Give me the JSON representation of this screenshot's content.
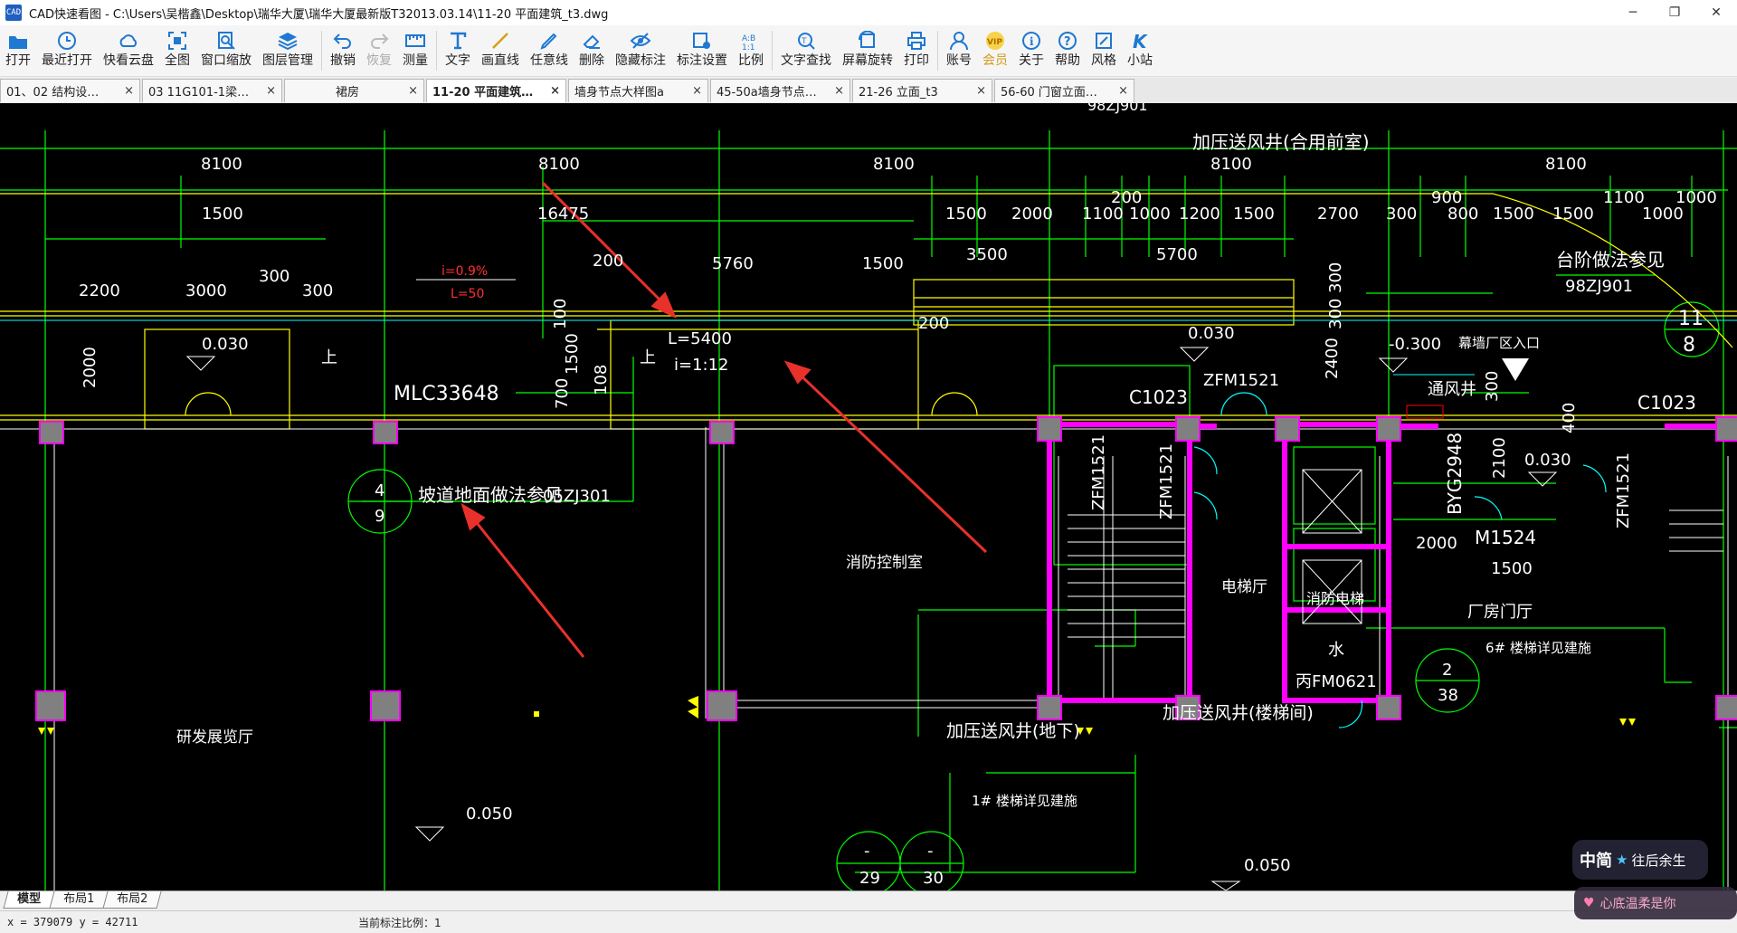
{
  "window": {
    "app_logo": "CAD",
    "title": "CAD快速看图 - C:\\Users\\吴楷鑫\\Desktop\\瑞华大厦\\瑞华大厦最新版T32013.03.14\\11-20 平面建筑_t3.dwg",
    "controls": {
      "minimize": "─",
      "maximize": "❐",
      "close": "✕"
    }
  },
  "toolbar": [
    {
      "label": "打开",
      "icon": "folder-icon"
    },
    {
      "label": "最近打开",
      "icon": "clock-icon"
    },
    {
      "label": "快看云盘",
      "icon": "cloud-icon"
    },
    {
      "label": "全图",
      "icon": "fullview-icon"
    },
    {
      "label": "窗口缩放",
      "icon": "zoom-window-icon"
    },
    {
      "label": "图层管理",
      "icon": "layers-icon"
    },
    {
      "label": "撤销",
      "icon": "undo-icon"
    },
    {
      "label": "恢复",
      "icon": "redo-icon",
      "disabled": true
    },
    {
      "label": "测量",
      "icon": "measure-icon"
    },
    {
      "label": "文字",
      "icon": "text-icon"
    },
    {
      "label": "画直线",
      "icon": "line-icon"
    },
    {
      "label": "任意线",
      "icon": "pen-icon"
    },
    {
      "label": "删除",
      "icon": "eraser-icon"
    },
    {
      "label": "隐藏标注",
      "icon": "eye-icon"
    },
    {
      "label": "标注设置",
      "icon": "gear-icon"
    },
    {
      "label": "比例",
      "icon": "ratio-icon"
    },
    {
      "label": "文字查找",
      "icon": "text-search-icon"
    },
    {
      "label": "屏幕旋转",
      "icon": "rotate-icon"
    },
    {
      "label": "打印",
      "icon": "printer-icon"
    },
    {
      "label": "账号",
      "icon": "user-icon"
    },
    {
      "label": "会员",
      "icon": "vip-icon",
      "gold": true
    },
    {
      "label": "关于",
      "icon": "info-icon"
    },
    {
      "label": "帮助",
      "icon": "help-icon"
    },
    {
      "label": "风格",
      "icon": "style-icon"
    },
    {
      "label": "小站",
      "icon": "k-icon"
    }
  ],
  "icon_glyphs": {
    "vip": "VIP",
    "ratio": "A:B",
    "k": "K",
    "help": "?",
    "info": "i"
  },
  "tabs": [
    {
      "label": "01、02 结构设…",
      "active": false
    },
    {
      "label": "03 11G101-1梁…",
      "active": false
    },
    {
      "label": "裙房",
      "active": false
    },
    {
      "label": "11-20 平面建筑…",
      "active": true
    },
    {
      "label": "墙身节点大样图a",
      "active": false
    },
    {
      "label": "45-50a墙身节点…",
      "active": false
    },
    {
      "label": "21-26 立面_t3",
      "active": false
    },
    {
      "label": "56-60 门窗立面…",
      "active": false
    }
  ],
  "tab_close": "×",
  "drawing": {
    "dims_top": [
      "8100",
      "8100",
      "8100",
      "8100",
      "8100"
    ],
    "dims_second": [
      "1500",
      "16475",
      "1500",
      "2000",
      "1100",
      "200",
      "1000",
      "1200",
      "1500",
      "2700",
      "300",
      "900",
      "800",
      "1500",
      "1500",
      "1100",
      "1000",
      "1000"
    ],
    "dims_third": [
      "2200",
      "3000",
      "300",
      "300",
      "200",
      "5760",
      "1500",
      "3500",
      "5700",
      "300",
      "300",
      "2400",
      "200"
    ],
    "labels": {
      "airshaft_top": "加压送风井(合用前室)",
      "top_ref": "98ZJ901",
      "slope": "i=0.9%",
      "slope_len": "L=50",
      "elev_030": "0.030",
      "elev_030b": "0.030",
      "elev_030c": "0.030",
      "elev_neg": "-0.300",
      "mlc": "MLC33648",
      "up": "上",
      "ramp_len": "L=5400",
      "ramp_slope": "i=1:12",
      "c1023a": "C1023",
      "c1023b": "C1023",
      "zfm1521a": "ZFM1521",
      "zfm1521b": "ZFM1521",
      "zfm1521c": "ZFM1521",
      "zfm1521d": "ZFM1521",
      "curtain": "幕墙厂区入口",
      "vent": "通风井",
      "steps_ref": "台阶做法参见",
      "steps_ref_code": "98ZJ901",
      "ramp_ref": "坡道地面做法参见",
      "ramp_ref_code": "05ZJ301",
      "fire_room": "消防控制室",
      "elevator_hall": "电梯厅",
      "fire_elevator": "消防电梯",
      "factory_hall": "厂房门厅",
      "byg": "BYG2948",
      "m1524": "M1524",
      "d2000": "2000",
      "d1500": "1500",
      "d2100": "2100",
      "d400": "400",
      "d300": "300",
      "d700": "700",
      "d100": "100",
      "d1500v": "1500",
      "d2000v": "2000",
      "d108": "108",
      "water": "水",
      "fm0621": "丙FM0621",
      "stair6": "6# 楼梯详见建施",
      "stair1": "1# 楼梯详见建施",
      "airshaft_stair": "加压送风井(楼梯间)",
      "airshaft_base": "加压送风井(地下)",
      "rd_hall": "研发展览厅",
      "elev_050a": "0.050",
      "elev_050b": "0.050",
      "bubble_4": "4",
      "bubble_9": "9",
      "bubble_11": "11",
      "bubble_8": "8",
      "bubble_2": "2",
      "bubble_38": "38",
      "bubble_dash1": "-",
      "bubble_29": "29",
      "bubble_dash2": "-",
      "bubble_30": "30"
    }
  },
  "layout_tabs": [
    {
      "label": "模型",
      "active": true
    },
    {
      "label": "布局1",
      "active": false
    },
    {
      "label": "布局2",
      "active": false
    }
  ],
  "status": {
    "coords": "x = 379079  y = 42711",
    "scale": "当前标注比例：1"
  },
  "overlays": {
    "badge1_logo": "中简",
    "badge1_star": "★",
    "badge1_text": "往后余生",
    "badge2_text": "心底温柔是你"
  },
  "colors": {
    "canvas_bg": "#000000",
    "cad_green": "#00ff00",
    "cad_yellow": "#ffff00",
    "cad_white": "#ffffff",
    "cad_magenta": "#ff00ff",
    "cad_cyan": "#00ffff",
    "arrow_red": "#e8312a",
    "column_fill": "#808080"
  }
}
